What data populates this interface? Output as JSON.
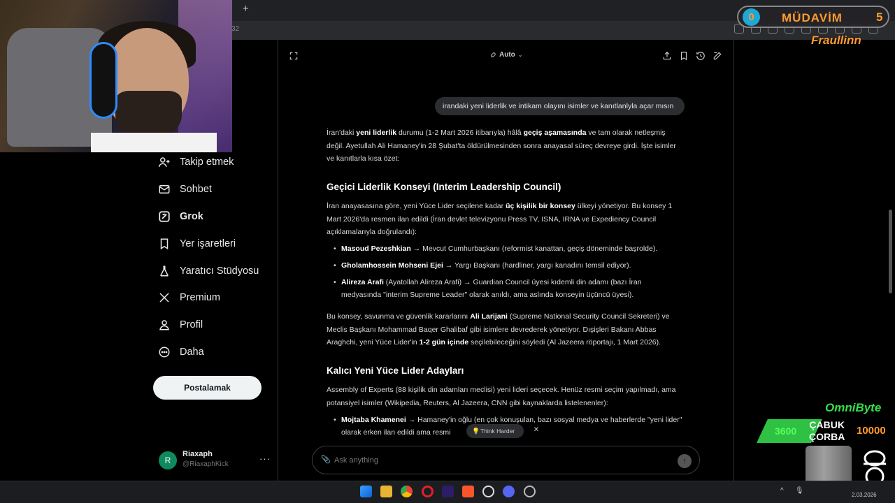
{
  "browser": {
    "new_tab": "+",
    "address_fragment": "32"
  },
  "sidebar": {
    "items": [
      {
        "label": "Takip etmek",
        "icon": "follow-icon"
      },
      {
        "label": "Sohbet",
        "icon": "mail-icon"
      },
      {
        "label": "Grok",
        "icon": "grok-icon",
        "active": true
      },
      {
        "label": "Yer işaretleri",
        "icon": "bookmark-icon"
      },
      {
        "label": "Yaratıcı Stüdyosu",
        "icon": "flask-icon"
      },
      {
        "label": "Premium",
        "icon": "x-logo-icon"
      },
      {
        "label": "Profil",
        "icon": "person-icon"
      },
      {
        "label": "Daha",
        "icon": "more-circle-icon"
      }
    ],
    "post_button": "Postalamak",
    "account": {
      "initial": "R",
      "name": "Riaxaph",
      "handle": "@RiaxaphKick",
      "more": "···"
    }
  },
  "grok": {
    "mode": "Auto",
    "user_message": "irandaki yeni liderlik ve intikam olayını isimler ve kanıtlanlyla açar mısın",
    "intro": {
      "p1": "İran'daki ",
      "b1": "yeni liderlik",
      "p2": " durumu (1-2 Mart 2026 itibarıyla) hâlâ ",
      "b2": "geçiş aşamasında",
      "p3": " ve tam olarak netleşmiş değil. Ayetullah Ali Hamaney'in 28 Şubat'ta öldürülmesinden sonra anayasal süreç devreye girdi. İşte isimler ve kanıtlarla kısa özet:"
    },
    "h1": "Geçici Liderlik Konseyi (Interim Leadership Council)",
    "council": {
      "p1": "İran anayasasına göre, yeni Yüce Lider seçilene kadar ",
      "b1": "üç kişilik bir konsey",
      "p2": " ülkeyi yönetiyor. Bu konsey 1 Mart 2026'da resmen ilan edildi (İran devlet televizyonu Press TV, ISNA, IRNA ve Expediency Council açıklamalarıyla doğrulandı):"
    },
    "bullets1": [
      {
        "name": "Masoud Pezeshkian",
        "text": " → Mevcut Cumhurbaşkanı (reformist kanattan, geçiş döneminde başrolde)."
      },
      {
        "name": "Gholamhossein Mohseni Ejei",
        "text": " → Yargı Başkanı (hardliner, yargı kanadını temsil ediyor)."
      },
      {
        "name": "Alireza Arafi",
        "text": " (Ayatollah Alireza Arafi) → Guardian Council üyesi kıdemli din adamı (bazı İran medyasında \"interim Supreme Leader\" olarak anıldı, ama aslında konseyin üçüncü üyesi)."
      }
    ],
    "security": {
      "p1": "Bu konsey, savunma ve güvenlik kararlarını ",
      "b1": "Ali Larijani",
      "p2": " (Supreme National Security Council Sekreteri) ve Meclis Başkanı Mohammad Baqer Ghalibaf gibi isimlere devrederek yönetiyor. Dışişleri Bakanı Abbas Araghchi, yeni Yüce Lider'in ",
      "b2": "1-2 gün içinde",
      "p3": " seçilebileceğini söyledi (Al Jazeera röportajı, 1 Mart 2026)."
    },
    "h2": "Kalıcı Yeni Yüce Lider Adayları",
    "experts": "Assembly of Experts (88 kişilik din adamları meclisi) yeni lideri seçecek. Henüz resmi seçim yapılmadı, ama potansiyel isimler (Wikipedia, Reuters, Al Jazeera, CNN gibi kaynaklarda listelenenler):",
    "bullets2": [
      {
        "name": "Mojtaba Khamenei",
        "text": " → Hamaney'in oğlu (en çok konuşulan, bazı sosyal medya ve haberlerde \"yeni lider\" olarak erken ilan edildi ama resmi"
      }
    ],
    "think_harder": "Think Harder",
    "ask_placeholder": "Ask anything"
  },
  "overlay": {
    "rank_level": "0",
    "rank_title": "MÜDAVİM",
    "rank_count": "5",
    "follower": "Fraullinn",
    "sub_name": "OmniByte",
    "bar_value": "3600",
    "reward_line1": "ÇABUK",
    "reward_line2": "ÇORBA",
    "reward_cost": "10000"
  },
  "taskbar": {
    "date": "2.03.2026"
  },
  "colors": {
    "accent_orange": "#ff9a2e",
    "accent_green": "#35e04a"
  }
}
